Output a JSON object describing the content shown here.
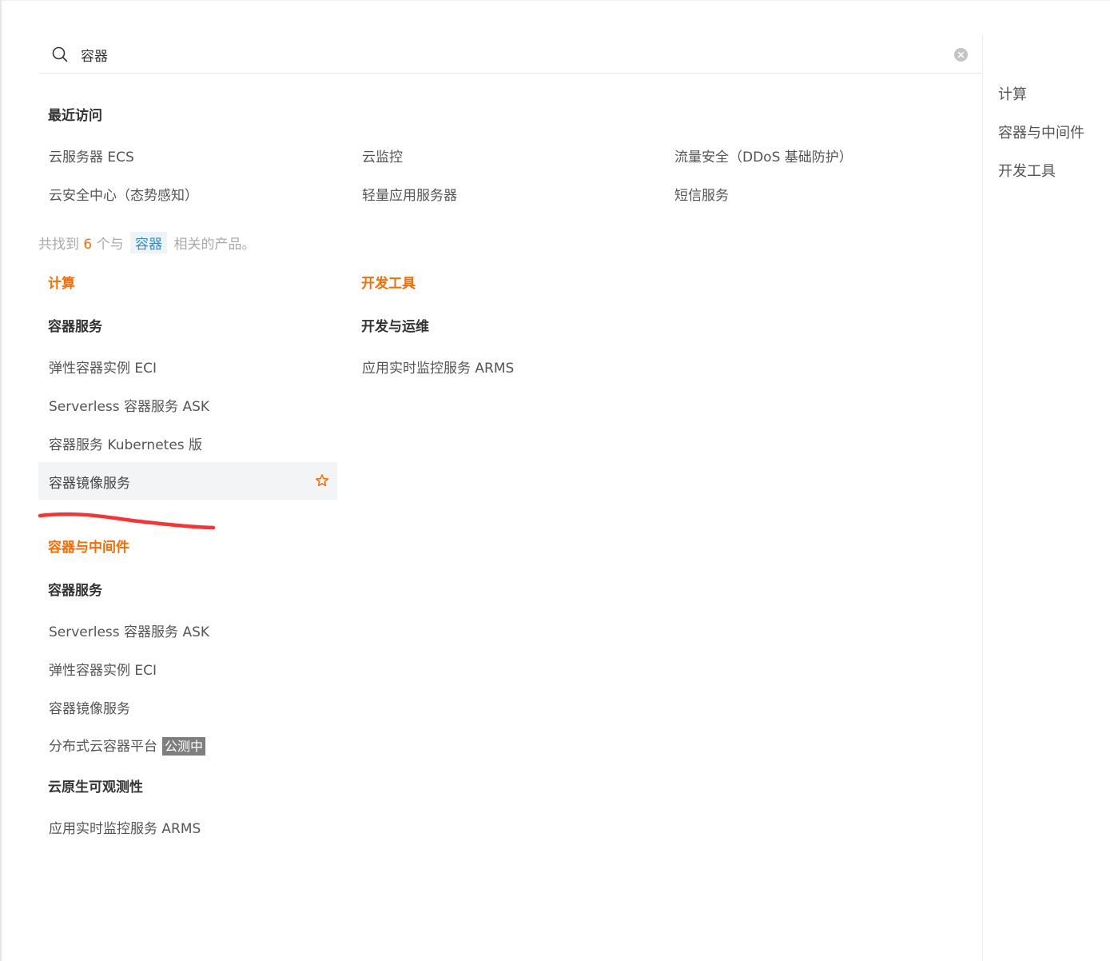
{
  "search": {
    "value": "容器",
    "icon": "search-icon",
    "clear_icon": "clear-icon"
  },
  "recent": {
    "title": "最近访问",
    "items": [
      "云服务器 ECS",
      "云监控",
      "流量安全（DDoS 基础防护）",
      "云安全中心（态势感知）",
      "轻量应用服务器",
      "短信服务"
    ]
  },
  "summary": {
    "prefix": "共找到",
    "count": "6",
    "middle": "个与",
    "keyword": "容器",
    "suffix": "相关的产品。"
  },
  "results": {
    "compute": {
      "title": "计算",
      "group": "容器服务",
      "items": [
        "弹性容器实例 ECI",
        "Serverless 容器服务 ASK",
        "容器服务 Kubernetes 版",
        "容器镜像服务"
      ]
    },
    "devtools": {
      "title": "开发工具",
      "group": "开发与运维",
      "items": [
        "应用实时监控服务 ARMS"
      ]
    },
    "middleware": {
      "title": "容器与中间件",
      "group1": "容器服务",
      "items1": [
        "Serverless 容器服务 ASK",
        "弹性容器实例 ECI",
        "容器镜像服务",
        "分布式云容器平台"
      ],
      "beta_badge": "公测中",
      "group2": "云原生可观测性",
      "items2": [
        "应用实时监控服务 ARMS"
      ]
    }
  },
  "side_nav": {
    "items": [
      "计算",
      "容器与中间件",
      "开发工具"
    ]
  },
  "colors": {
    "accent": "#ff6a00",
    "keyword_text": "#2c8ed8",
    "annotation_stroke": "#ff3030"
  }
}
